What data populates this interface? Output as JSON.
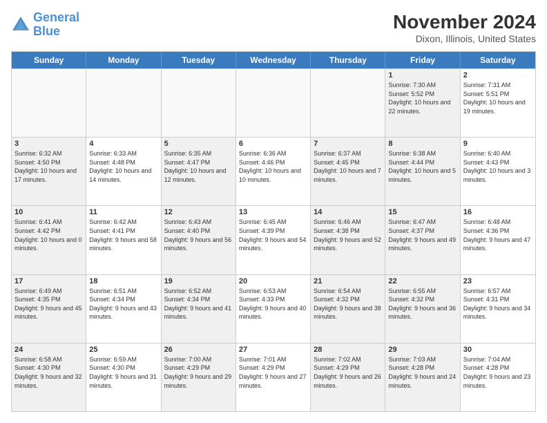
{
  "logo": {
    "text_general": "General",
    "text_blue": "Blue"
  },
  "title": "November 2024",
  "subtitle": "Dixon, Illinois, United States",
  "header_days": [
    "Sunday",
    "Monday",
    "Tuesday",
    "Wednesday",
    "Thursday",
    "Friday",
    "Saturday"
  ],
  "rows": [
    [
      {
        "day": "",
        "info": "",
        "empty": true
      },
      {
        "day": "",
        "info": "",
        "empty": true
      },
      {
        "day": "",
        "info": "",
        "empty": true
      },
      {
        "day": "",
        "info": "",
        "empty": true
      },
      {
        "day": "",
        "info": "",
        "empty": true
      },
      {
        "day": "1",
        "info": "Sunrise: 7:30 AM\nSunset: 5:52 PM\nDaylight: 10 hours and 22 minutes.",
        "shaded": true
      },
      {
        "day": "2",
        "info": "Sunrise: 7:31 AM\nSunset: 5:51 PM\nDaylight: 10 hours and 19 minutes.",
        "shaded": false
      }
    ],
    [
      {
        "day": "3",
        "info": "Sunrise: 6:32 AM\nSunset: 4:50 PM\nDaylight: 10 hours and 17 minutes.",
        "shaded": true
      },
      {
        "day": "4",
        "info": "Sunrise: 6:33 AM\nSunset: 4:48 PM\nDaylight: 10 hours and 14 minutes.",
        "shaded": false
      },
      {
        "day": "5",
        "info": "Sunrise: 6:35 AM\nSunset: 4:47 PM\nDaylight: 10 hours and 12 minutes.",
        "shaded": true
      },
      {
        "day": "6",
        "info": "Sunrise: 6:36 AM\nSunset: 4:46 PM\nDaylight: 10 hours and 10 minutes.",
        "shaded": false
      },
      {
        "day": "7",
        "info": "Sunrise: 6:37 AM\nSunset: 4:45 PM\nDaylight: 10 hours and 7 minutes.",
        "shaded": true
      },
      {
        "day": "8",
        "info": "Sunrise: 6:38 AM\nSunset: 4:44 PM\nDaylight: 10 hours and 5 minutes.",
        "shaded": true
      },
      {
        "day": "9",
        "info": "Sunrise: 6:40 AM\nSunset: 4:43 PM\nDaylight: 10 hours and 3 minutes.",
        "shaded": false
      }
    ],
    [
      {
        "day": "10",
        "info": "Sunrise: 6:41 AM\nSunset: 4:42 PM\nDaylight: 10 hours and 0 minutes.",
        "shaded": true
      },
      {
        "day": "11",
        "info": "Sunrise: 6:42 AM\nSunset: 4:41 PM\nDaylight: 9 hours and 58 minutes.",
        "shaded": false
      },
      {
        "day": "12",
        "info": "Sunrise: 6:43 AM\nSunset: 4:40 PM\nDaylight: 9 hours and 56 minutes.",
        "shaded": true
      },
      {
        "day": "13",
        "info": "Sunrise: 6:45 AM\nSunset: 4:39 PM\nDaylight: 9 hours and 54 minutes.",
        "shaded": false
      },
      {
        "day": "14",
        "info": "Sunrise: 6:46 AM\nSunset: 4:38 PM\nDaylight: 9 hours and 52 minutes.",
        "shaded": true
      },
      {
        "day": "15",
        "info": "Sunrise: 6:47 AM\nSunset: 4:37 PM\nDaylight: 9 hours and 49 minutes.",
        "shaded": true
      },
      {
        "day": "16",
        "info": "Sunrise: 6:48 AM\nSunset: 4:36 PM\nDaylight: 9 hours and 47 minutes.",
        "shaded": false
      }
    ],
    [
      {
        "day": "17",
        "info": "Sunrise: 6:49 AM\nSunset: 4:35 PM\nDaylight: 9 hours and 45 minutes.",
        "shaded": true
      },
      {
        "day": "18",
        "info": "Sunrise: 6:51 AM\nSunset: 4:34 PM\nDaylight: 9 hours and 43 minutes.",
        "shaded": false
      },
      {
        "day": "19",
        "info": "Sunrise: 6:52 AM\nSunset: 4:34 PM\nDaylight: 9 hours and 41 minutes.",
        "shaded": true
      },
      {
        "day": "20",
        "info": "Sunrise: 6:53 AM\nSunset: 4:33 PM\nDaylight: 9 hours and 40 minutes.",
        "shaded": false
      },
      {
        "day": "21",
        "info": "Sunrise: 6:54 AM\nSunset: 4:32 PM\nDaylight: 9 hours and 38 minutes.",
        "shaded": true
      },
      {
        "day": "22",
        "info": "Sunrise: 6:55 AM\nSunset: 4:32 PM\nDaylight: 9 hours and 36 minutes.",
        "shaded": true
      },
      {
        "day": "23",
        "info": "Sunrise: 6:57 AM\nSunset: 4:31 PM\nDaylight: 9 hours and 34 minutes.",
        "shaded": false
      }
    ],
    [
      {
        "day": "24",
        "info": "Sunrise: 6:58 AM\nSunset: 4:30 PM\nDaylight: 9 hours and 32 minutes.",
        "shaded": true
      },
      {
        "day": "25",
        "info": "Sunrise: 6:59 AM\nSunset: 4:30 PM\nDaylight: 9 hours and 31 minutes.",
        "shaded": false
      },
      {
        "day": "26",
        "info": "Sunrise: 7:00 AM\nSunset: 4:29 PM\nDaylight: 9 hours and 29 minutes.",
        "shaded": true
      },
      {
        "day": "27",
        "info": "Sunrise: 7:01 AM\nSunset: 4:29 PM\nDaylight: 9 hours and 27 minutes.",
        "shaded": false
      },
      {
        "day": "28",
        "info": "Sunrise: 7:02 AM\nSunset: 4:29 PM\nDaylight: 9 hours and 26 minutes.",
        "shaded": true
      },
      {
        "day": "29",
        "info": "Sunrise: 7:03 AM\nSunset: 4:28 PM\nDaylight: 9 hours and 24 minutes.",
        "shaded": true
      },
      {
        "day": "30",
        "info": "Sunrise: 7:04 AM\nSunset: 4:28 PM\nDaylight: 9 hours and 23 minutes.",
        "shaded": false
      }
    ]
  ]
}
